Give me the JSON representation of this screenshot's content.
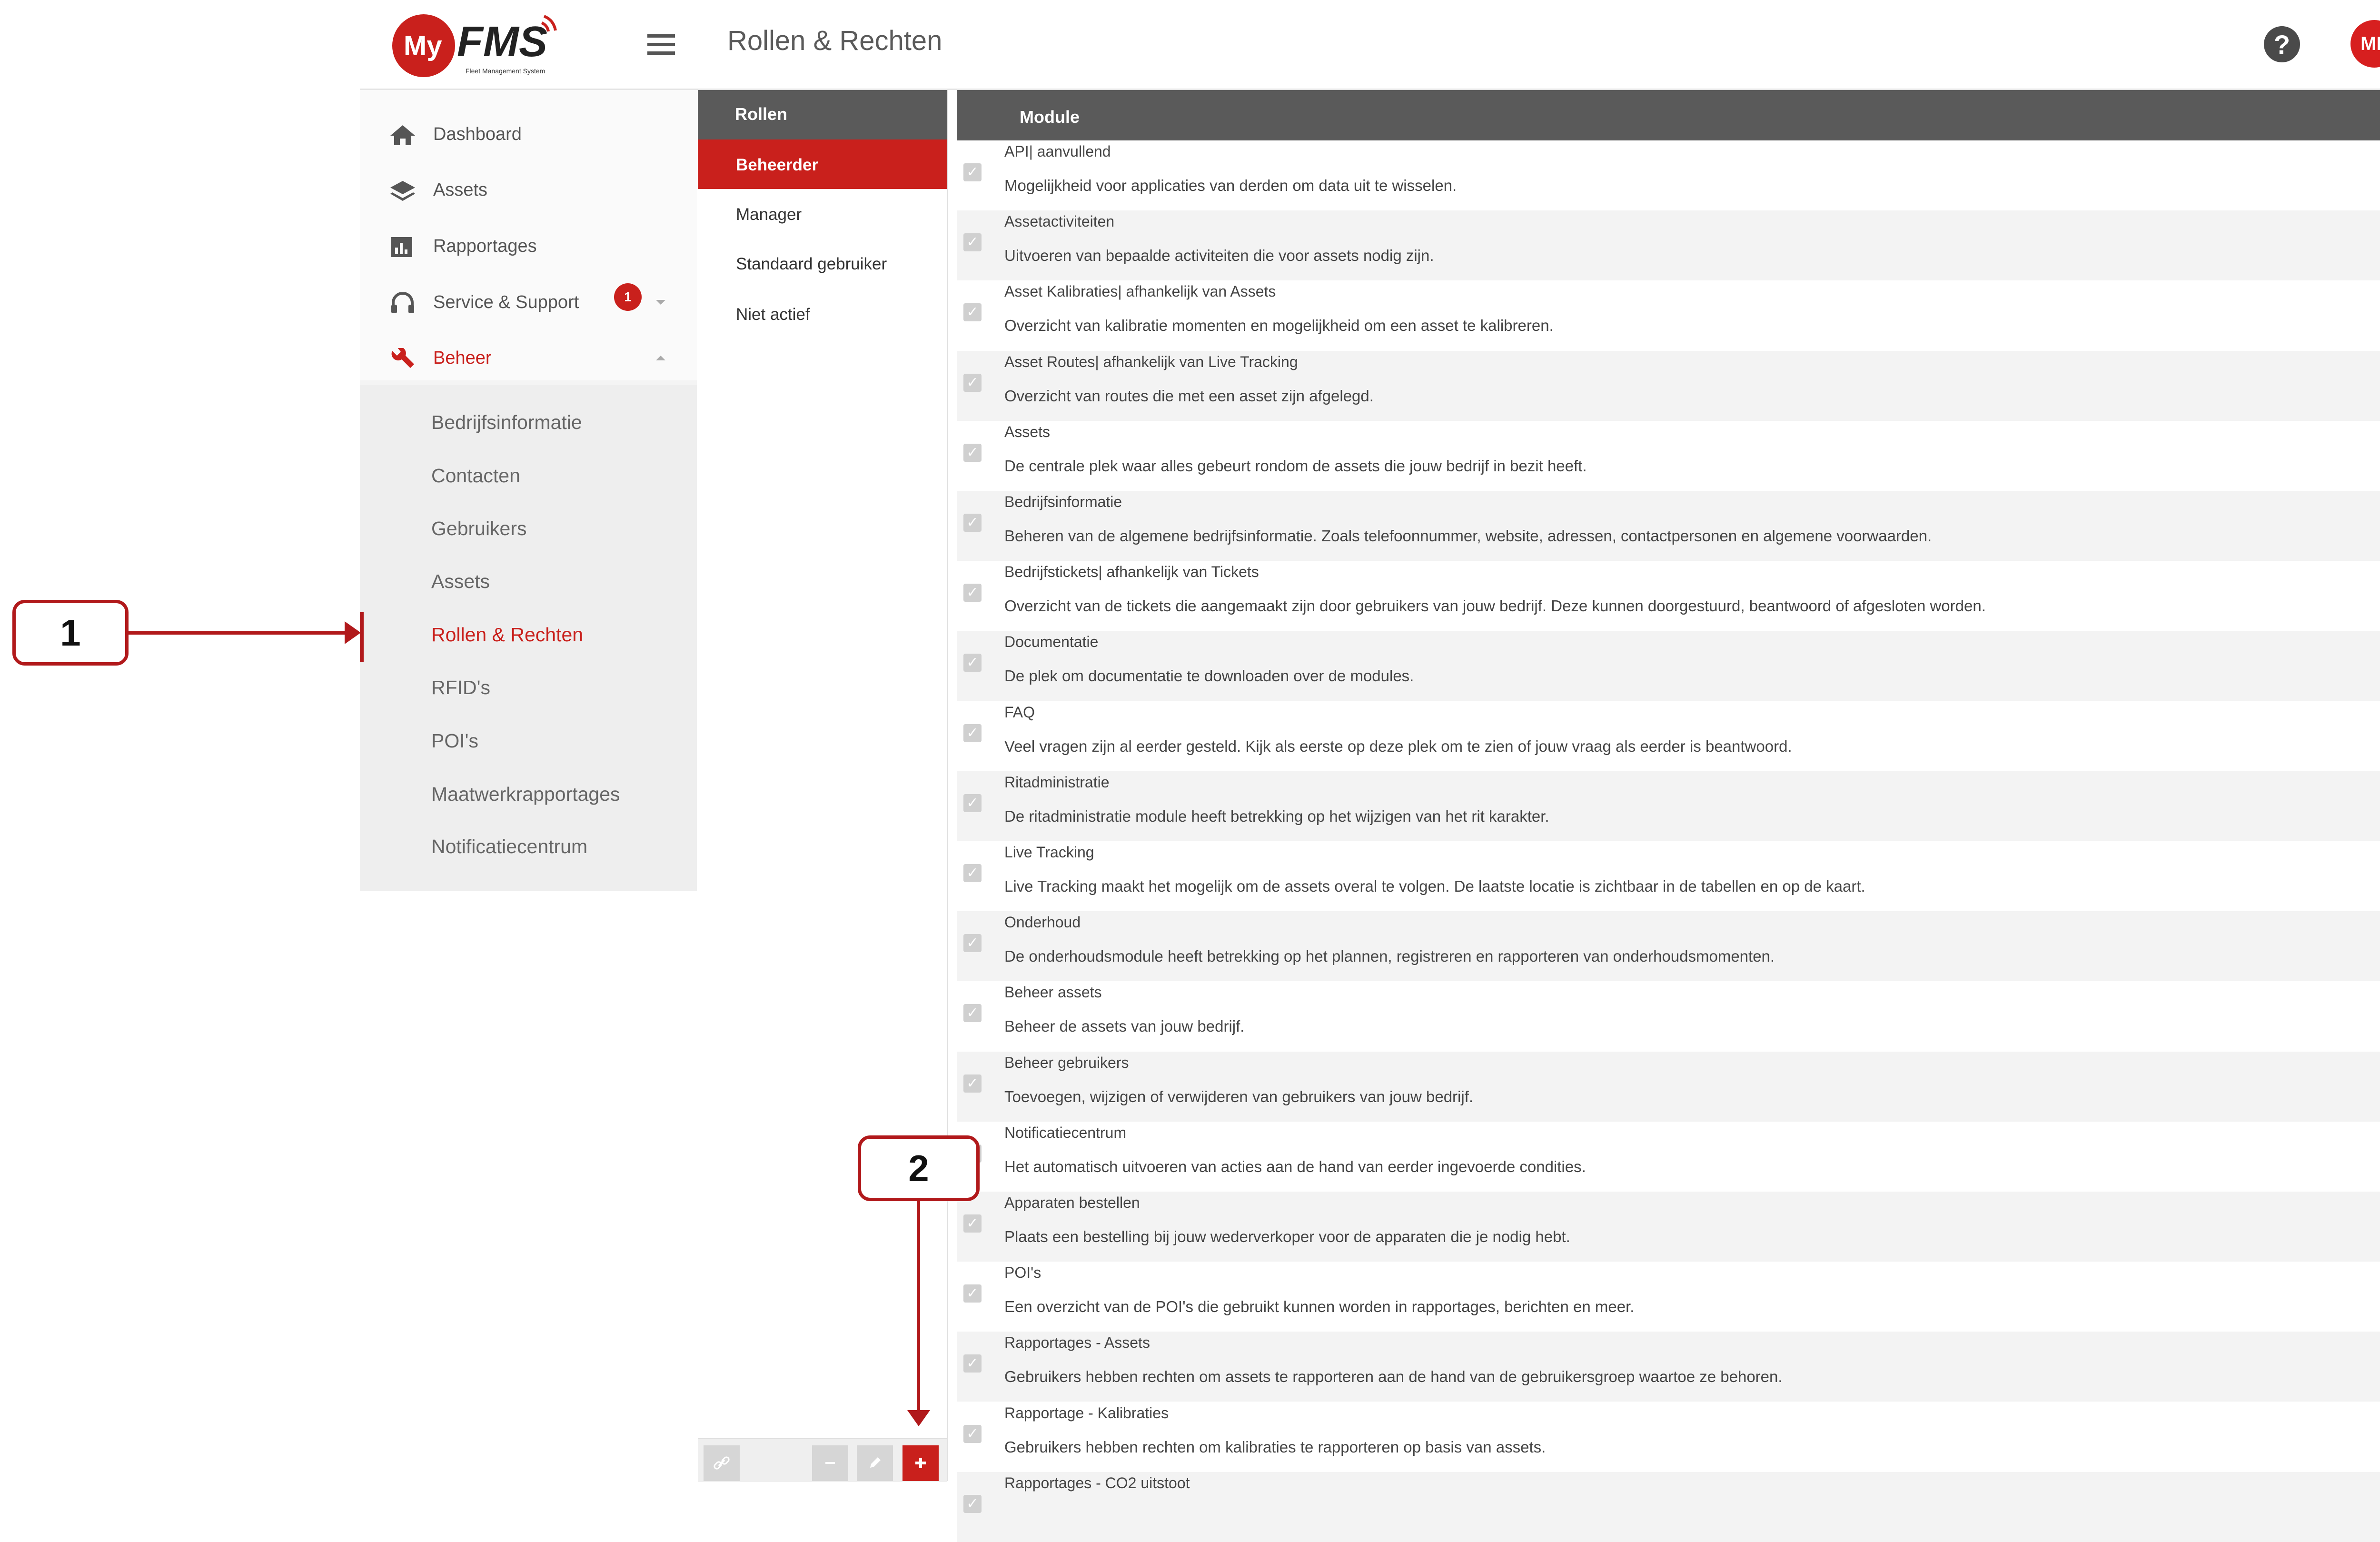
{
  "app": {
    "logo_text_my": "My",
    "logo_text_fms": "FMS",
    "logo_tagline": "Fleet Management System",
    "page_title": "Rollen & Rechten",
    "avatar_initials": "MF",
    "help_symbol": "?"
  },
  "sidebar": {
    "items": [
      {
        "label": "Dashboard",
        "icon": "home-icon"
      },
      {
        "label": "Assets",
        "icon": "layers-icon"
      },
      {
        "label": "Rapportages",
        "icon": "bar-chart-icon"
      },
      {
        "label": "Service & Support",
        "icon": "headset-icon",
        "badge": "1"
      },
      {
        "label": "Beheer",
        "icon": "wrench-icon"
      }
    ],
    "subitems": [
      "Bedrijfsinformatie",
      "Contacten",
      "Gebruikers",
      "Assets",
      "Rollen & Rechten",
      "RFID's",
      "POI's",
      "Maatwerkrapportages",
      "Notificatiecentrum"
    ],
    "active_subitem": "Rollen & Rechten"
  },
  "roles": {
    "header": "Rollen",
    "items": [
      "Beheerder",
      "Manager",
      "Standaard gebruiker",
      "Niet actief"
    ],
    "active": "Beheerder",
    "footer_buttons": [
      "link",
      "remove",
      "edit",
      "add"
    ]
  },
  "modules": {
    "header": "Module",
    "rows": [
      {
        "title": "API| aanvullend",
        "desc": "Mogelijkheid voor applicaties van derden om data uit te wisselen."
      },
      {
        "title": "Assetactiviteiten",
        "desc": "Uitvoeren van bepaalde activiteiten die voor assets nodig zijn."
      },
      {
        "title": "Asset Kalibraties| afhankelijk van Assets",
        "desc": "Overzicht van kalibratie momenten en mogelijkheid om een asset te kalibreren."
      },
      {
        "title": "Asset Routes| afhankelijk van Live Tracking",
        "desc": "Overzicht van routes die met een asset zijn afgelegd."
      },
      {
        "title": "Assets",
        "desc": "De centrale plek waar alles gebeurt rondom de assets die jouw bedrijf in bezit heeft."
      },
      {
        "title": "Bedrijfsinformatie",
        "desc": "Beheren van de algemene bedrijfsinformatie. Zoals telefoonnummer, website, adressen, contactpersonen en algemene voorwaarden."
      },
      {
        "title": "Bedrijfstickets| afhankelijk van Tickets",
        "desc": "Overzicht van de tickets die aangemaakt zijn door gebruikers van jouw bedrijf. Deze kunnen doorgestuurd, beantwoord of afgesloten worden."
      },
      {
        "title": "Documentatie",
        "desc": "De plek om documentatie te downloaden over de modules."
      },
      {
        "title": "FAQ",
        "desc": "Veel vragen zijn al eerder gesteld. Kijk als eerste op deze plek om te zien of jouw vraag als eerder is beantwoord."
      },
      {
        "title": "Ritadministratie",
        "desc": "De ritadministratie module heeft betrekking op het wijzigen van het rit karakter."
      },
      {
        "title": "Live Tracking",
        "desc": "Live Tracking maakt het mogelijk om de assets overal te volgen. De laatste locatie is zichtbaar in de tabellen en op de kaart."
      },
      {
        "title": "Onderhoud",
        "desc": "De onderhoudsmodule heeft betrekking op het plannen, registreren en rapporteren van onderhoudsmomenten."
      },
      {
        "title": "Beheer assets",
        "desc": "Beheer de assets van jouw bedrijf."
      },
      {
        "title": "Beheer gebruikers",
        "desc": "Toevoegen, wijzigen of verwijderen van gebruikers van jouw bedrijf."
      },
      {
        "title": "Notificatiecentrum",
        "desc": "Het automatisch uitvoeren van acties aan de hand van eerder ingevoerde condities."
      },
      {
        "title": "Apparaten bestellen",
        "desc": "Plaats een bestelling bij jouw wederverkoper voor de apparaten die je nodig hebt."
      },
      {
        "title": "POI's",
        "desc": "Een overzicht van de POI's die gebruikt kunnen worden in rapportages, berichten en meer."
      },
      {
        "title": "Rapportages - Assets",
        "desc": "Gebruikers hebben rechten om assets te rapporteren aan de hand van de gebruikersgroep waartoe ze behoren."
      },
      {
        "title": "Rapportage - Kalibraties",
        "desc": "Gebruikers hebben rechten om kalibraties te rapporteren op basis van assets."
      },
      {
        "title": "Rapportages - CO2 uitstoot",
        "desc": ""
      }
    ]
  },
  "annotations": {
    "callout_1": "1",
    "callout_2": "2"
  },
  "colors": {
    "accent": "#c9201c",
    "header_gray": "#5a5a5a",
    "annotation": "#b1191b"
  }
}
